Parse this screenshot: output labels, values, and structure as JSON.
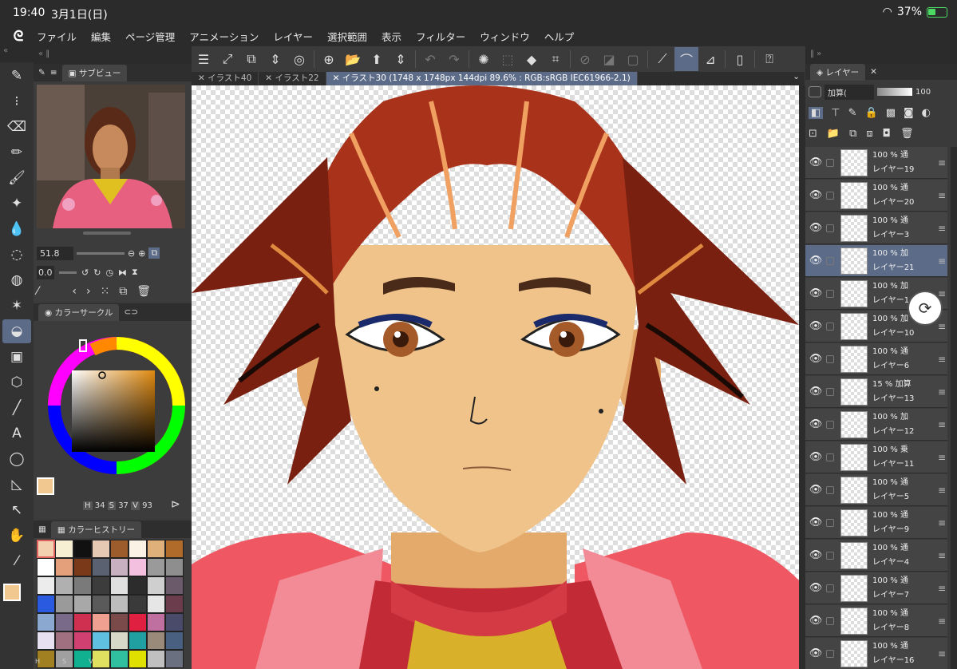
{
  "status": {
    "time": "19:40",
    "date": "3月1日(日)",
    "battery": "37%"
  },
  "menu": [
    "ファイル",
    "編集",
    "ページ管理",
    "アニメーション",
    "レイヤー",
    "選択範囲",
    "表示",
    "フィルター",
    "ウィンドウ",
    "ヘルプ"
  ],
  "subview": {
    "tab": "サブビュー",
    "zoom": "51.8",
    "rotate": "0.0"
  },
  "colorcircle": {
    "tab": "カラーサークル",
    "h_label": "H",
    "h": "34",
    "s_label": "S",
    "s": "37",
    "v_label": "V",
    "v": "93",
    "main_color": "#f0c890"
  },
  "colorhistory": {
    "tab": "カラーヒストリー",
    "swatches": [
      "#f3d0b0",
      "#f7efd4",
      "#111111",
      "#e6c9b4",
      "#9c5c2c",
      "#fbf2e6",
      "#e0b07a",
      "#b06a2a",
      "#ffffff",
      "#e3a07a",
      "#7a3a1a",
      "#5a6272",
      "#c8b0c0",
      "#f4c0e0",
      "#9a9a9a",
      "#8e8e8e",
      "#ececec",
      "#b0b0b0",
      "#7a7a7a",
      "#3c3c3c",
      "#e0e0e0",
      "#2c2c2c",
      "#cfcfcf",
      "#6a5a6a",
      "#2a5ae0",
      "#9a9a9a",
      "#a8a8a8",
      "#5a5a5a",
      "#bcbcbc",
      "#3a3a3a",
      "#e6e6e6",
      "#6a3c4c",
      "#8aa8d0",
      "#7a6a8a",
      "#d03050",
      "#f0a090",
      "#7a4a4a",
      "#e02040",
      "#c070a0",
      "#4a4a6a",
      "#e7e0f0",
      "#a07080",
      "#d04070",
      "#60c0e0",
      "#d8d8c8",
      "#20a0a0",
      "#9a8a7a",
      "#4a6080",
      "#a08020",
      "#a0a0a0",
      "#10b090",
      "#e0e060",
      "#30c0a0",
      "#e0e000",
      "#c0c0c0",
      "#6a7080"
    ],
    "hsv_labels": [
      "H",
      "S",
      "V"
    ]
  },
  "doctabs": [
    {
      "label": "イラスト40"
    },
    {
      "label": "イラスト22"
    },
    {
      "label": "イラスト30 (1748 x 1748px 144dpi 89.6% : RGB:sRGB IEC61966-2.1)"
    }
  ],
  "layers": {
    "tab": "レイヤー",
    "blend": "加算(",
    "opacity": "100",
    "items": [
      {
        "pct": "100 % 通",
        "name": "レイヤー19"
      },
      {
        "pct": "100 % 通",
        "name": "レイヤー20"
      },
      {
        "pct": "100 % 通",
        "name": "レイヤー3"
      },
      {
        "pct": "100 % 加",
        "name": "レイヤー21"
      },
      {
        "pct": "100 % 加",
        "name": "レイヤー1"
      },
      {
        "pct": "100 % 加",
        "name": "レイヤー10"
      },
      {
        "pct": "100 % 通",
        "name": "レイヤー6"
      },
      {
        "pct": "15 % 加算",
        "name": "レイヤー13"
      },
      {
        "pct": "100 % 加",
        "name": "レイヤー12"
      },
      {
        "pct": "100 % 乗",
        "name": "レイヤー11"
      },
      {
        "pct": "100 % 通",
        "name": "レイヤー5"
      },
      {
        "pct": "100 % 通",
        "name": "レイヤー9"
      },
      {
        "pct": "100 % 通",
        "name": "レイヤー4"
      },
      {
        "pct": "100 % 通",
        "name": "レイヤー7"
      },
      {
        "pct": "100 % 通",
        "name": "レイヤー8"
      },
      {
        "pct": "100 % 通",
        "name": "レイヤー16"
      }
    ]
  }
}
